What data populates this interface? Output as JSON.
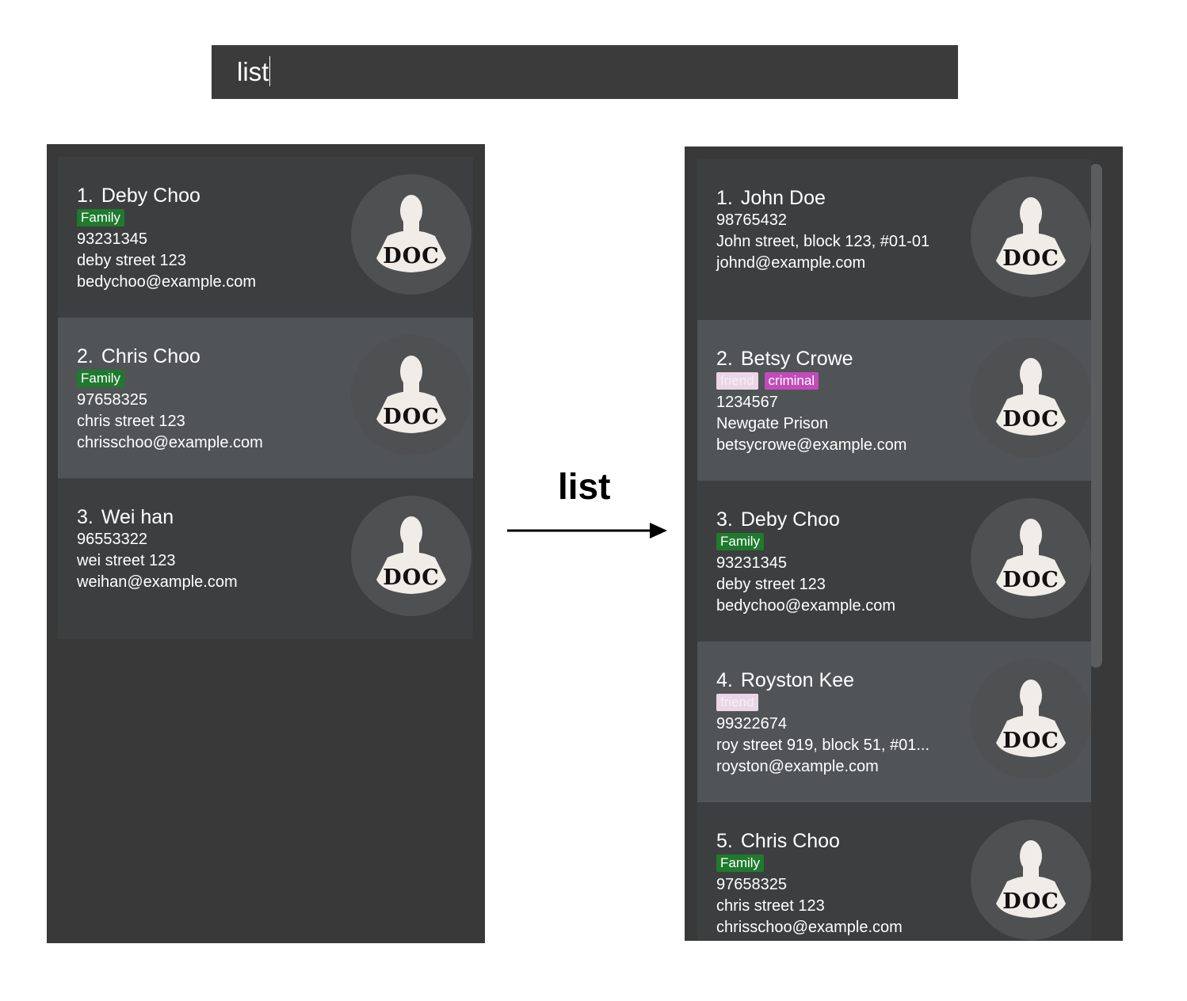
{
  "command": {
    "value": "list"
  },
  "arrow_label": "list",
  "before": {
    "cards": [
      {
        "index": "1.",
        "name": "Deby Choo",
        "tags": [
          {
            "label": "Family",
            "kind": "family"
          }
        ],
        "phone": "93231345",
        "address": "deby street 123",
        "email": "bedychoo@example.com",
        "avatar": "DOC"
      },
      {
        "index": "2.",
        "name": "Chris Choo",
        "tags": [
          {
            "label": "Family",
            "kind": "family"
          }
        ],
        "phone": "97658325",
        "address": "chris street 123",
        "email": "chrisschoo@example.com",
        "avatar": "DOC"
      },
      {
        "index": "3.",
        "name": "Wei han",
        "tags": [],
        "phone": "96553322",
        "address": "wei street 123",
        "email": "weihan@example.com",
        "avatar": "DOC"
      }
    ]
  },
  "after": {
    "cards": [
      {
        "index": "1.",
        "name": "John Doe",
        "tags": [],
        "phone": "98765432",
        "address": "John street, block 123, #01-01",
        "email": "johnd@example.com",
        "avatar": "DOC"
      },
      {
        "index": "2.",
        "name": "Betsy Crowe",
        "tags": [
          {
            "label": "friend",
            "kind": "friend"
          },
          {
            "label": "criminal",
            "kind": "criminal"
          }
        ],
        "phone": "1234567",
        "address": "Newgate Prison",
        "email": "betsycrowe@example.com",
        "avatar": "DOC"
      },
      {
        "index": "3.",
        "name": "Deby Choo",
        "tags": [
          {
            "label": "Family",
            "kind": "family"
          }
        ],
        "phone": "93231345",
        "address": "deby street 123",
        "email": "bedychoo@example.com",
        "avatar": "DOC"
      },
      {
        "index": "4.",
        "name": "Royston Kee",
        "tags": [
          {
            "label": "friend",
            "kind": "friend"
          }
        ],
        "phone": "99322674",
        "address": "roy street 919, block 51, #01...",
        "email": "royston@example.com",
        "avatar": "DOC"
      },
      {
        "index": "5.",
        "name": "Chris Choo",
        "tags": [
          {
            "label": "Family",
            "kind": "family"
          }
        ],
        "phone": "97658325",
        "address": "chris street 123",
        "email": "chrisschoo@example.com",
        "avatar": "DOC"
      }
    ]
  },
  "colors": {
    "tag_family": "#1f7a2e",
    "tag_friend": "#ead6e6",
    "tag_criminal": "#c24bb9",
    "panel_bg": "#393939",
    "card_dark": "#3c3e3f",
    "card_light": "#505456"
  }
}
